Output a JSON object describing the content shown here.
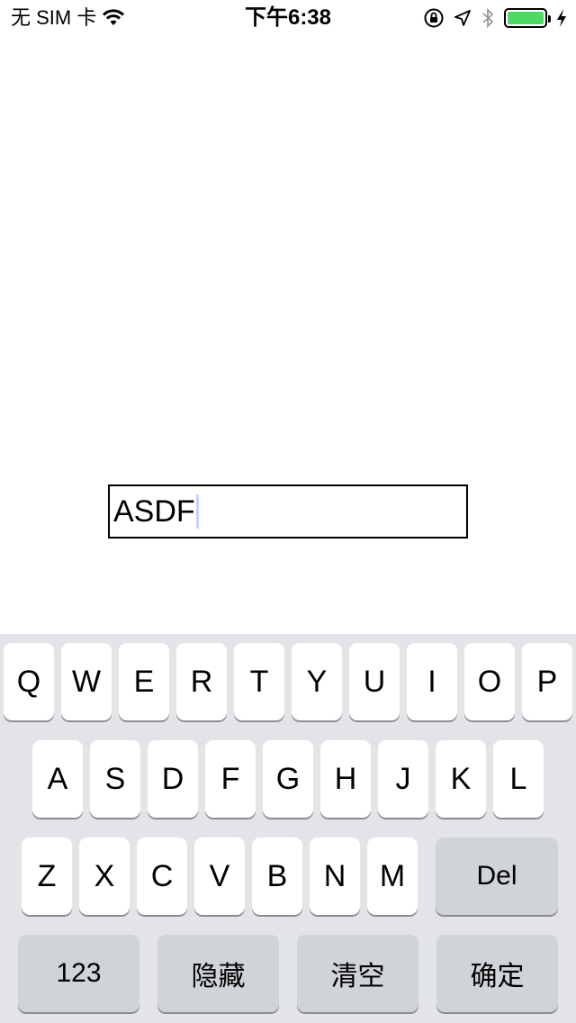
{
  "status_bar": {
    "carrier": "无 SIM 卡",
    "time": "下午6:38",
    "battery_level": 1.0,
    "battery_color": "#4cd964"
  },
  "input": {
    "value": "ASDF",
    "caret_color": "#c6d2ff"
  },
  "keyboard": {
    "row1": [
      "Q",
      "W",
      "E",
      "R",
      "T",
      "Y",
      "U",
      "I",
      "O",
      "P"
    ],
    "row2": [
      "A",
      "S",
      "D",
      "F",
      "G",
      "H",
      "J",
      "K",
      "L"
    ],
    "row3": [
      "Z",
      "X",
      "C",
      "V",
      "B",
      "N",
      "M"
    ],
    "delete_label": "Del",
    "bottom": {
      "numbers_label": "123",
      "hide_label": "隐藏",
      "clear_label": "清空",
      "confirm_label": "确定"
    }
  }
}
